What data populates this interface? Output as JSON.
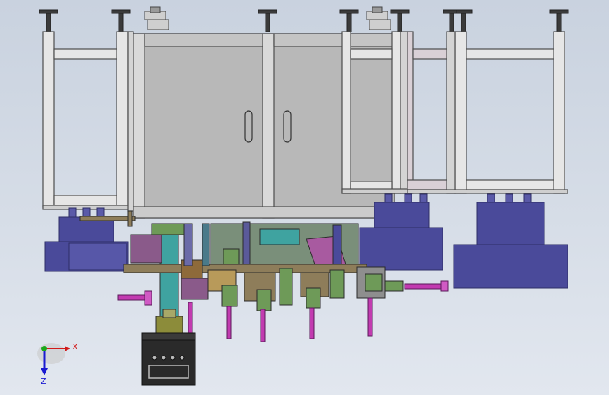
{
  "viewport": {
    "background_top": "#c9d2df",
    "background_bottom": "#e2e7ef"
  },
  "model": {
    "frame_color": "#e6e6e6",
    "frame_edge_color": "#4d4d4d",
    "cabinet_color": "#b8b8b8",
    "base_color": "#4a4a9a",
    "cylinder_color": "#c23bb0",
    "green_part_color": "#6e9a58",
    "teal_part_color": "#3fa3a0"
  },
  "triad": {
    "x_label": "X",
    "z_label": "Z",
    "x_color": "#d11a1a",
    "y_color": "#1aa81a",
    "z_color": "#1a1ad1"
  }
}
